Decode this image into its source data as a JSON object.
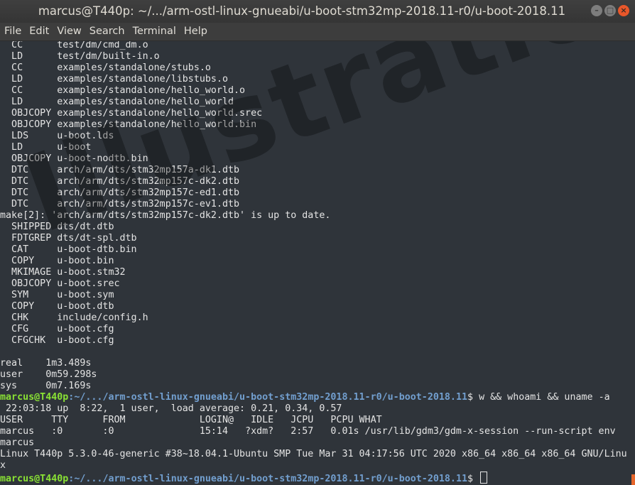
{
  "window": {
    "title": "marcus@T440p: ~/.../arm-ostl-linux-gnueabi/u-boot-stm32mp-2018.11-r0/u-boot-2018.11"
  },
  "menu": [
    "File",
    "Edit",
    "View",
    "Search",
    "Terminal",
    "Help"
  ],
  "watermark": "Illustration",
  "colors": {
    "background": "#2f343a",
    "prompt_user": "#8ae234",
    "prompt_path": "#729fcf",
    "close_button": "#e9572a"
  },
  "terminal": {
    "build_lines": [
      "  CC      test/dm/cmd_dm.o",
      "  LD      test/dm/built-in.o",
      "  CC      examples/standalone/stubs.o",
      "  LD      examples/standalone/libstubs.o",
      "  CC      examples/standalone/hello_world.o",
      "  LD      examples/standalone/hello_world",
      "  OBJCOPY examples/standalone/hello_world.srec",
      "  OBJCOPY examples/standalone/hello_world.bin",
      "  LDS     u-boot.lds",
      "  LD      u-boot",
      "  OBJCOPY u-boot-nodtb.bin",
      "  DTC     arch/arm/dts/stm32mp157a-dk1.dtb",
      "  DTC     arch/arm/dts/stm32mp157c-dk2.dtb",
      "  DTC     arch/arm/dts/stm32mp157c-ed1.dtb",
      "  DTC     arch/arm/dts/stm32mp157c-ev1.dtb",
      "make[2]: 'arch/arm/dts/stm32mp157c-dk2.dtb' is up to date.",
      "  SHIPPED dts/dt.dtb",
      "  FDTGREP dts/dt-spl.dtb",
      "  CAT     u-boot-dtb.bin",
      "  COPY    u-boot.bin",
      "  MKIMAGE u-boot.stm32",
      "  OBJCOPY u-boot.srec",
      "  SYM     u-boot.sym",
      "  COPY    u-boot.dtb",
      "  CHK     include/config.h",
      "  CFG     u-boot.cfg",
      "  CFGCHK  u-boot.cfg",
      "",
      "real\t1m3.489s",
      "user\t0m59.298s",
      "sys\t0m7.169s"
    ],
    "prompt": {
      "user_host": "marcus@T440p",
      "path": ":~/.../arm-ostl-linux-gnueabi/u-boot-stm32mp-2018.11-r0/u-boot-2018.11",
      "symbol": "$ "
    },
    "command": "w && whoami && uname -a",
    "output_lines": [
      " 22:03:18 up  8:22,  1 user,  load average: 0.21, 0.34, 0.57",
      "USER     TTY      FROM             LOGIN@   IDLE   JCPU   PCPU WHAT",
      "marcus   :0       :0               15:14   ?xdm?   2:57   0.01s /usr/lib/gdm3/gdm-x-session --run-script env",
      "marcus",
      "Linux T440p 5.3.0-46-generic #38~18.04.1-Ubuntu SMP Tue Mar 31 04:17:56 UTC 2020 x86_64 x86_64 x86_64 GNU/Linu",
      "x"
    ]
  }
}
